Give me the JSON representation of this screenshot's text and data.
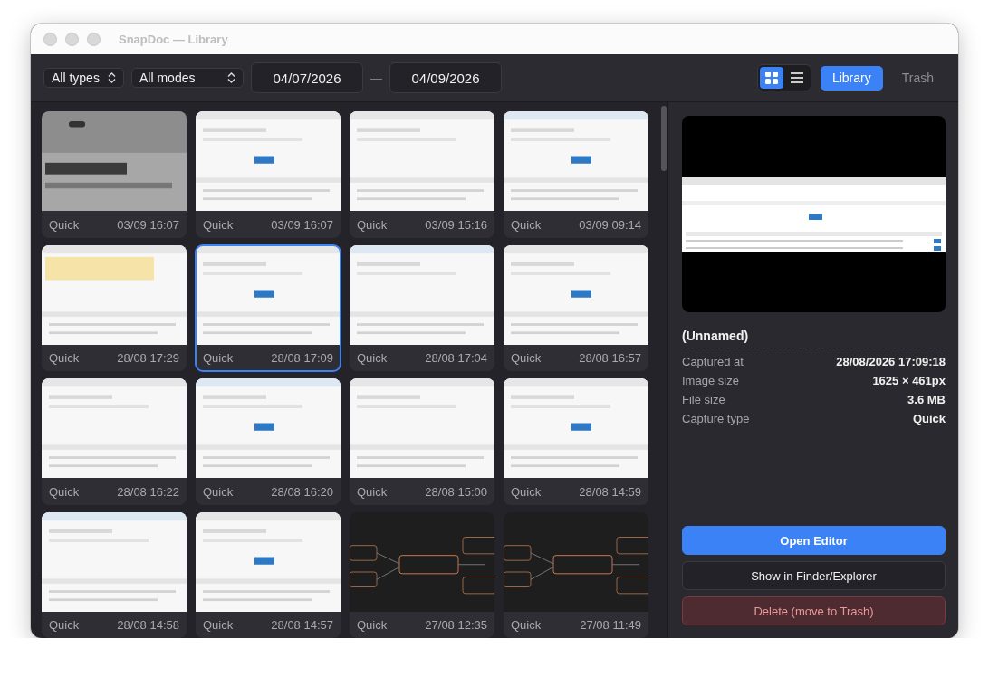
{
  "window": {
    "title": "SnapDoc — Library"
  },
  "toolbar": {
    "type_filter": "All types",
    "mode_filter": "All modes",
    "date_from": "04/07/2026",
    "date_separator": "—",
    "date_to": "04/09/2026",
    "view_modes": [
      {
        "kind": "grid",
        "selected": true
      },
      {
        "kind": "list",
        "selected": false
      }
    ],
    "sections": [
      {
        "label": "Library",
        "selected": true
      },
      {
        "label": "Trash",
        "selected": false
      }
    ]
  },
  "captures": [
    {
      "kind": "picture",
      "mode": "Quick",
      "time": "03/09 16:07",
      "selected": false
    },
    {
      "kind": "picture",
      "mode": "Quick",
      "time": "03/09 16:07",
      "selected": false
    },
    {
      "kind": "picture",
      "mode": "Quick",
      "time": "03/09 15:16",
      "selected": false
    },
    {
      "kind": "picture",
      "mode": "Quick",
      "time": "03/09 09:14",
      "selected": false
    },
    {
      "kind": "picture",
      "mode": "Quick",
      "time": "28/08 17:29",
      "selected": false
    },
    {
      "kind": "picture",
      "mode": "Quick",
      "time": "28/08 17:09",
      "selected": true
    },
    {
      "kind": "picture",
      "mode": "Quick",
      "time": "28/08 17:04",
      "selected": false
    },
    {
      "kind": "picture",
      "mode": "Quick",
      "time": "28/08 16:57",
      "selected": false
    },
    {
      "kind": "picture",
      "mode": "Quick",
      "time": "28/08 16:22",
      "selected": false
    },
    {
      "kind": "picture",
      "mode": "Quick",
      "time": "28/08 16:20",
      "selected": false
    },
    {
      "kind": "picture",
      "mode": "Quick",
      "time": "28/08 15:00",
      "selected": false
    },
    {
      "kind": "picture",
      "mode": "Quick",
      "time": "28/08 14:59",
      "selected": false
    },
    {
      "kind": "picture",
      "mode": "Quick",
      "time": "28/08 14:58",
      "selected": false
    },
    {
      "kind": "picture",
      "mode": "Quick",
      "time": "28/08 14:57",
      "selected": false
    },
    {
      "kind": "picture",
      "mode": "Quick",
      "time": "27/08 12:35",
      "selected": false
    },
    {
      "kind": "picture",
      "mode": "Quick",
      "time": "27/08 11:49",
      "selected": false
    }
  ],
  "details": {
    "name": "(Unnamed)",
    "fields": [
      {
        "label": "Captured at",
        "value": "28/08/2026 17:09:18"
      },
      {
        "label": "Image size",
        "value": "1625 × 461px"
      },
      {
        "label": "File size",
        "value": "3.6 MB"
      },
      {
        "label": "Capture type",
        "value": "Quick"
      }
    ]
  },
  "actions": [
    {
      "kind": "primary",
      "label": "Open Editor"
    },
    {
      "kind": "secondary",
      "label": "Show in Finder/Explorer"
    },
    {
      "kind": "danger",
      "label": "Delete (move to Trash)"
    }
  ]
}
